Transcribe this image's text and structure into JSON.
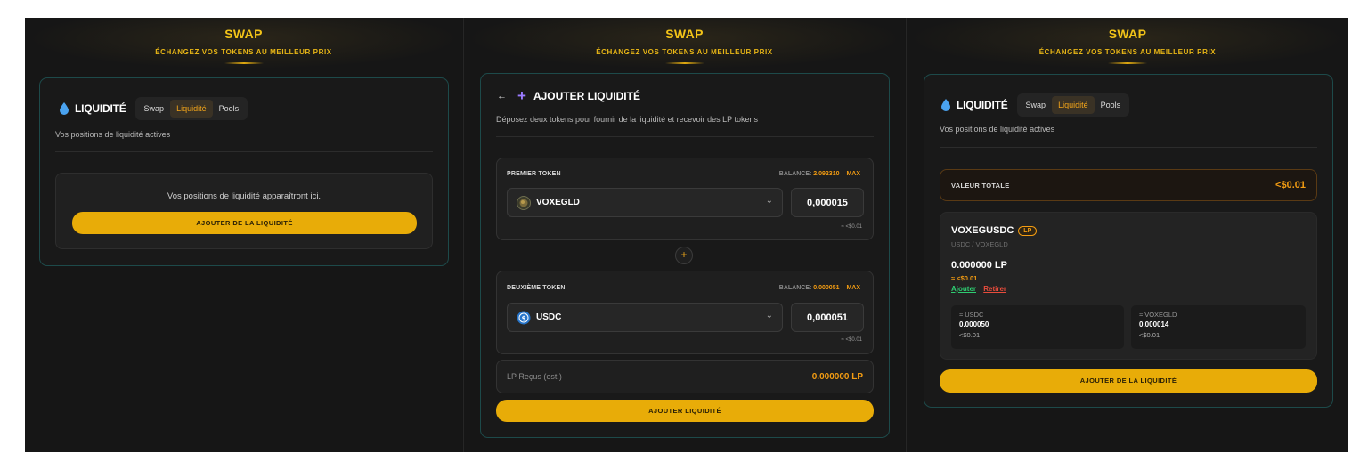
{
  "header": {
    "title": "SWAP",
    "subtitle": "ÉCHANGEZ VOS TOKENS AU MEILLEUR PRIX"
  },
  "tabs": {
    "swap": "Swap",
    "liquidite": "Liquidité",
    "pools": "Pools"
  },
  "panel1": {
    "title": "LIQUIDITÉ",
    "subtitle": "Vos positions de liquidité actives",
    "empty_text": "Vos positions de liquidité apparaîtront ici.",
    "add_button": "AJOUTER DE LA LIQUIDITÉ"
  },
  "panel2": {
    "back_icon": "←",
    "plus_icon": "+",
    "title": "AJOUTER LIQUIDITÉ",
    "subtitle": "Déposez deux tokens pour fournir de la liquidité et recevoir des LP tokens",
    "first": {
      "label": "PREMIER TOKEN",
      "balance_label": "BALANCE:",
      "balance_value": "2.092310",
      "max": "MAX",
      "token": "VOXEGLD",
      "amount": "0,000015",
      "approx": "≈ <$0.01"
    },
    "second": {
      "label": "DEUXIÈME TOKEN",
      "balance_label": "BALANCE:",
      "balance_value": "0.000051",
      "max": "MAX",
      "token": "USDC",
      "amount": "0,000051",
      "approx": "≈ <$0.01"
    },
    "plus_sep": "+",
    "lp_label": "LP Reçus (est.)",
    "lp_value": "0.000000 LP",
    "add_button": "AJOUTER LIQUIDITÉ"
  },
  "panel3": {
    "title": "LIQUIDITÉ",
    "subtitle": "Vos positions de liquidité actives",
    "total_label": "VALEUR TOTALE",
    "total_value": "<$0.01",
    "position": {
      "name": "VOXEGUSDC",
      "badge": "LP",
      "pair": "USDC / VOXEGLD",
      "lp_amount": "0.000000 LP",
      "lp_value": "≈ <$0.01",
      "add_link": "Ajouter",
      "remove_link": "Retirer",
      "left": {
        "label": "≈ USDC",
        "amount": "0.000050",
        "value": "<$0.01"
      },
      "right": {
        "label": "≈ VOXEGLD",
        "amount": "0.000014",
        "value": "<$0.01"
      }
    },
    "add_button": "AJOUTER DE LA LIQUIDITÉ"
  },
  "colors": {
    "accent": "#e8ac08",
    "orange": "#f39c12",
    "border": "#1d4a4a",
    "green": "#2ecc71",
    "red": "#e74c3c"
  },
  "icons": [
    "water-drop-icon",
    "back-arrow-icon",
    "plus-icon",
    "chevron-down-icon",
    "voxegld-token-icon",
    "usdc-token-icon"
  ]
}
